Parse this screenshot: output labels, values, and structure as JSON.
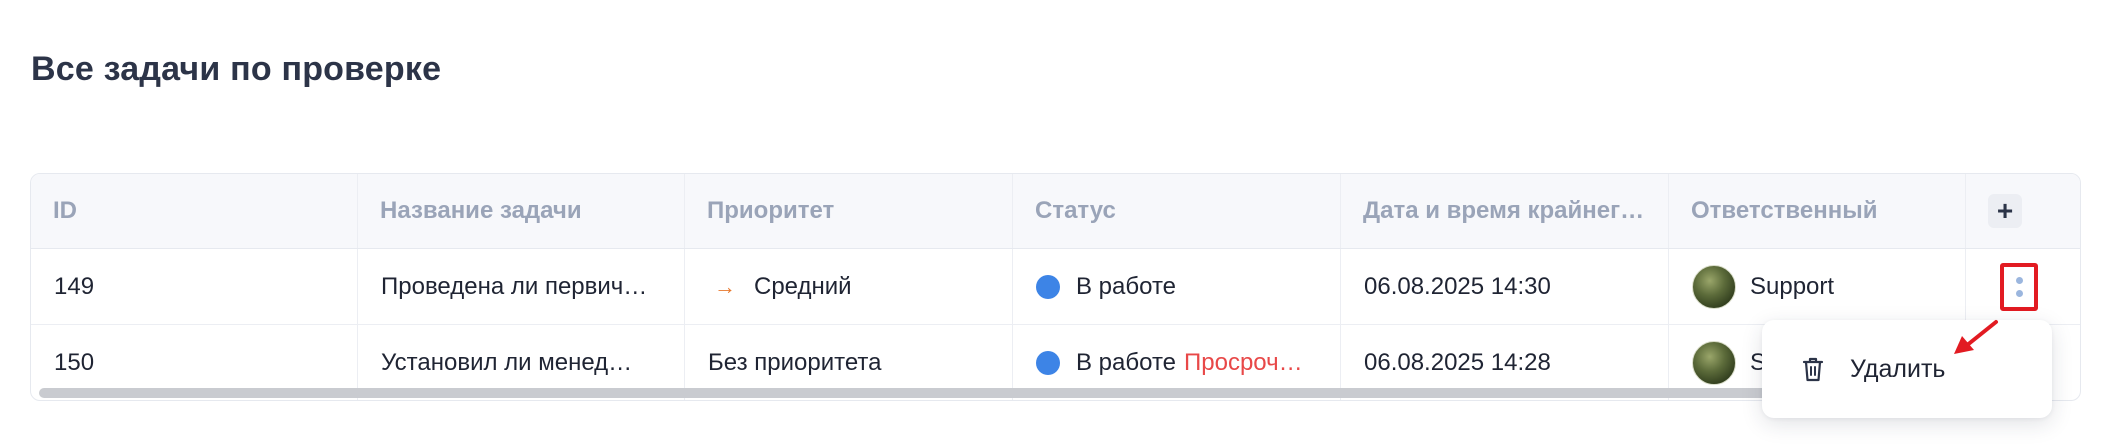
{
  "page": {
    "title": "Все задачи по проверке"
  },
  "table": {
    "columns": [
      "ID",
      "Название задачи",
      "Приоритет",
      "Статус",
      "Дата и время крайнег…",
      "Ответственный"
    ],
    "add_column_label": "+",
    "rows": [
      {
        "id": "149",
        "name": "Проведена ли первич…",
        "priority": "Средний",
        "priority_icon": "arrow-right-icon",
        "status": "В работе",
        "overdue": "",
        "deadline": "06.08.2025 14:30",
        "assignee": "Support"
      },
      {
        "id": "150",
        "name": "Установил ли менед…",
        "priority": "Без приоритета",
        "priority_icon": "",
        "status": "В работе",
        "overdue": "Просроч…",
        "deadline": "06.08.2025 14:28",
        "assignee": "S"
      }
    ]
  },
  "context_menu": {
    "delete_label": "Удалить",
    "delete_icon": "trash-icon"
  },
  "colors": {
    "status_dot": "#3d84e6",
    "overdue": "#e84848",
    "priority_arrow": "#e8792e",
    "highlight": "#e21b22"
  }
}
